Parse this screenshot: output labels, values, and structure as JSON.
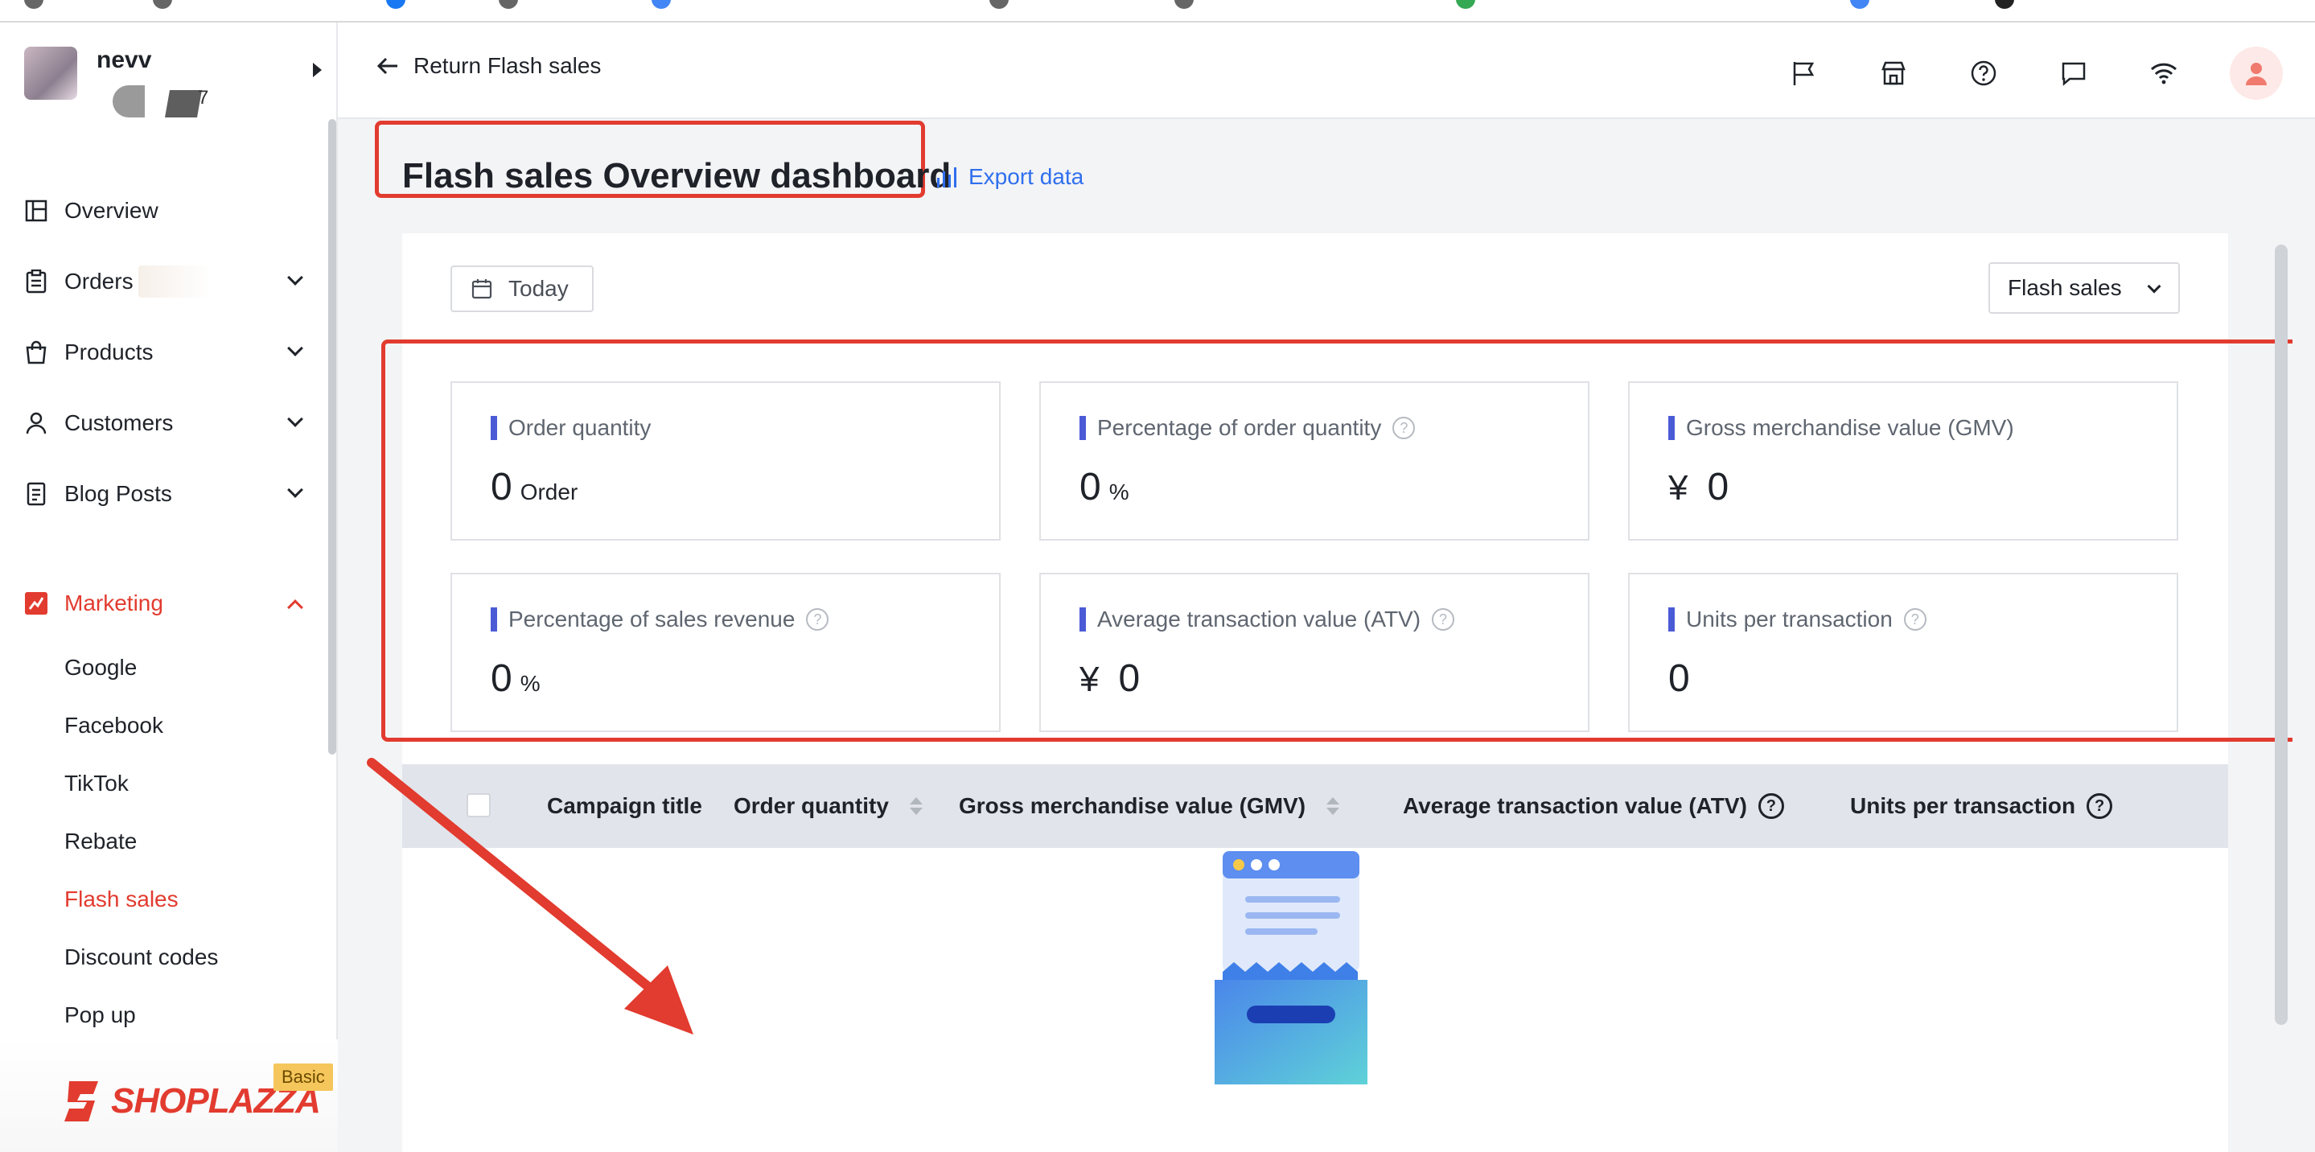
{
  "store": {
    "name": "nevv",
    "sub_number": "7"
  },
  "sidebar": {
    "items": [
      {
        "label": "Overview"
      },
      {
        "label": "Orders"
      },
      {
        "label": "Products"
      },
      {
        "label": "Customers"
      },
      {
        "label": "Blog Posts"
      },
      {
        "label": "Marketing"
      }
    ],
    "marketing_sub": [
      {
        "label": "Google"
      },
      {
        "label": "Facebook"
      },
      {
        "label": "TikTok"
      },
      {
        "label": "Rebate"
      },
      {
        "label": "Flash sales"
      },
      {
        "label": "Discount codes"
      },
      {
        "label": "Pop up"
      }
    ],
    "brand": "SHOPLAZZA",
    "plan_badge": "Basic"
  },
  "header": {
    "back_label": "Return Flash sales",
    "icons": [
      "flag-icon",
      "store-icon",
      "help-icon",
      "chat-icon",
      "wifi-icon",
      "user-avatar-icon"
    ]
  },
  "page": {
    "title": "Flash sales Overview dashboard",
    "export_label": "Export data"
  },
  "filters": {
    "date_label": "Today",
    "campaign_select": "Flash sales"
  },
  "metrics": [
    {
      "label": "Order quantity",
      "value": "0",
      "unit": "Order",
      "has_help": false
    },
    {
      "label": "Percentage of order quantity",
      "value": "0",
      "unit": "%",
      "has_help": true
    },
    {
      "label": "Gross merchandise value (GMV)",
      "currency": "¥",
      "value": "0",
      "has_help": false
    },
    {
      "label": "Percentage of sales revenue",
      "value": "0",
      "unit": "%",
      "has_help": true
    },
    {
      "label": "Average transaction value (ATV)",
      "currency": "¥",
      "value": "0",
      "has_help": true
    },
    {
      "label": "Units per transaction",
      "value": "0",
      "has_help": true
    }
  ],
  "table": {
    "columns": [
      "Campaign title",
      "Order quantity",
      "Gross merchandise value (GMV)",
      "Average transaction value (ATV)",
      "Units per transaction"
    ]
  },
  "colors": {
    "accent": "#e23b2f",
    "link": "#2f6fed",
    "metric_bar": "#4b5bd6",
    "table_header": "#e1e4ea"
  }
}
